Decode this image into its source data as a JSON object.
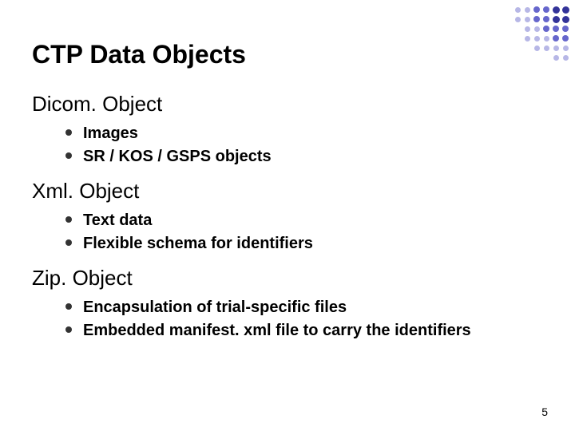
{
  "title": "CTP Data Objects",
  "sections": [
    {
      "heading": "Dicom. Object",
      "items": [
        "Images",
        "SR / KOS / GSPS objects"
      ]
    },
    {
      "heading": "Xml. Object",
      "items": [
        "Text data",
        "Flexible schema for identifiers"
      ]
    },
    {
      "heading": "Zip. Object",
      "items": [
        "Encapsulation of trial-specific files",
        "Embedded manifest. xml file to carry the identifiers"
      ]
    }
  ],
  "page_number": "5",
  "decoration_colors": {
    "outer": "#b7b7e6",
    "mid": "#6666cc",
    "inner": "#333399"
  }
}
